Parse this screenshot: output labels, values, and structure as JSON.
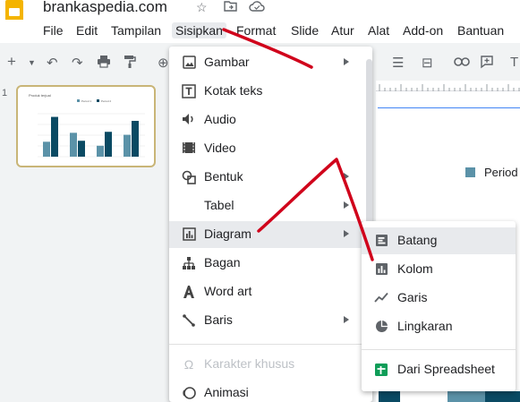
{
  "app": {
    "title": "brankaspedia.com",
    "star_icon": "star-icon",
    "folder_icon": "move-folder-icon",
    "cloud_icon": "cloud-status-icon"
  },
  "menubar": [
    {
      "label": "File"
    },
    {
      "label": "Edit"
    },
    {
      "label": "Tampilan"
    },
    {
      "label": "Sisipkan"
    },
    {
      "label": "Format"
    },
    {
      "label": "Slide"
    },
    {
      "label": "Atur"
    },
    {
      "label": "Alat"
    },
    {
      "label": "Add-on"
    },
    {
      "label": "Bantuan"
    }
  ],
  "slides": {
    "current_number": "1",
    "thumb_title": "Produk terjual",
    "thumb_series": [
      {
        "name": "Period 1",
        "values": [
          15,
          24,
          11,
          22
        ]
      },
      {
        "name": "Period 2",
        "values": [
          40,
          16,
          25,
          36
        ]
      }
    ],
    "thumb_colors": [
      "#5b92a8",
      "#0a4a63"
    ]
  },
  "canvas": {
    "legend_label": "Period",
    "legend_color": "#5b92a8"
  },
  "insert_menu": {
    "items": [
      {
        "label": "Gambar",
        "icon": "image-icon",
        "submenu": true
      },
      {
        "label": "Kotak teks",
        "icon": "text-box-icon",
        "submenu": false
      },
      {
        "label": "Audio",
        "icon": "audio-icon",
        "submenu": false
      },
      {
        "label": "Video",
        "icon": "video-icon",
        "submenu": false
      },
      {
        "label": "Bentuk",
        "icon": "shape-icon",
        "submenu": true
      },
      {
        "label": "Tabel",
        "icon": "",
        "submenu": true
      },
      {
        "label": "Diagram",
        "icon": "chart-icon",
        "submenu": true
      },
      {
        "label": "Bagan",
        "icon": "diagram-icon",
        "submenu": false
      },
      {
        "label": "Word art",
        "icon": "word-art-icon",
        "submenu": false
      },
      {
        "label": "Baris",
        "icon": "line-icon",
        "submenu": true
      },
      {
        "label": "Karakter khusus",
        "icon": "omega-icon",
        "submenu": false
      },
      {
        "label": "Animasi",
        "icon": "animation-icon",
        "submenu": false
      }
    ]
  },
  "chart_submenu": {
    "items": [
      {
        "label": "Batang",
        "icon": "bar-chart-icon"
      },
      {
        "label": "Kolom",
        "icon": "column-chart-icon"
      },
      {
        "label": "Garis",
        "icon": "line-chart-icon"
      },
      {
        "label": "Lingkaran",
        "icon": "pie-chart-icon"
      },
      {
        "label": "Dari Spreadsheet",
        "icon": "sheets-icon"
      }
    ]
  },
  "colors": {
    "annotation": "#d0021b",
    "sheets_green": "#0f9d58"
  }
}
